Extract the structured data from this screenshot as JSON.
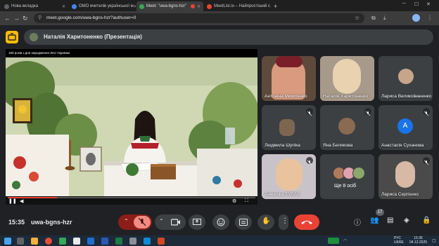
{
  "browser": {
    "tabs": [
      {
        "label": "Нова вкладка",
        "fav_color": "#5f6368",
        "active": false
      },
      {
        "label": "ОМО вчителів української м",
        "fav_color": "#4285f4",
        "active": false
      },
      {
        "label": "Meet: \"uwa-bgns-hzr\"",
        "fav_color": "#34a853",
        "active": true
      },
      {
        "label": "MeetList.io – Найпростіший с",
        "fav_color": "#ea4335",
        "active": false
      }
    ],
    "new_tab_label": "+",
    "url": "meet.google.com/uwa-bgns-hzr?authuser=0"
  },
  "meet": {
    "presenter_label": "Наталія Харитоненко (Презентація)",
    "presentation_title": "150 років з дня народження Лесі Українки",
    "clock": "15:35",
    "meeting_code": "uwa-bgns-hzr",
    "participant_count": "17",
    "participants": [
      {
        "name": "Антоніна Микитенко",
        "avatar_letter": "",
        "muted": false
      },
      {
        "name": "Наталія Харитоненко",
        "avatar_letter": "",
        "muted": false
      },
      {
        "name": "Лариса Великоіваненко",
        "avatar_letter": "",
        "muted": false
      },
      {
        "name": "Людмила Шупіка",
        "avatar_letter": "",
        "muted": true
      },
      {
        "name": "Яна Белякова",
        "avatar_letter": "",
        "muted": true
      },
      {
        "name": "Анастасія Суханова",
        "avatar_letter": "A",
        "muted": true
      },
      {
        "name": "Анжеліка БУЛАХ",
        "avatar_letter": "",
        "muted": true
      },
      {
        "name": "Ще 8 осіб",
        "avatar_letter": "",
        "muted": false
      },
      {
        "name": "Лариса Сергієнко",
        "avatar_letter": "",
        "muted": true
      }
    ]
  },
  "taskbar": {
    "lang_top": "РУС",
    "lang_bottom": "UKRE",
    "time": "15:35",
    "date": "04.12.2025"
  },
  "colors": {
    "accent_yellow": "#fbbc04",
    "end_call_red": "#ea4335",
    "mic_off_red": "#8c1d18",
    "meet_bg": "#202124",
    "control_grey": "#3c4043"
  }
}
